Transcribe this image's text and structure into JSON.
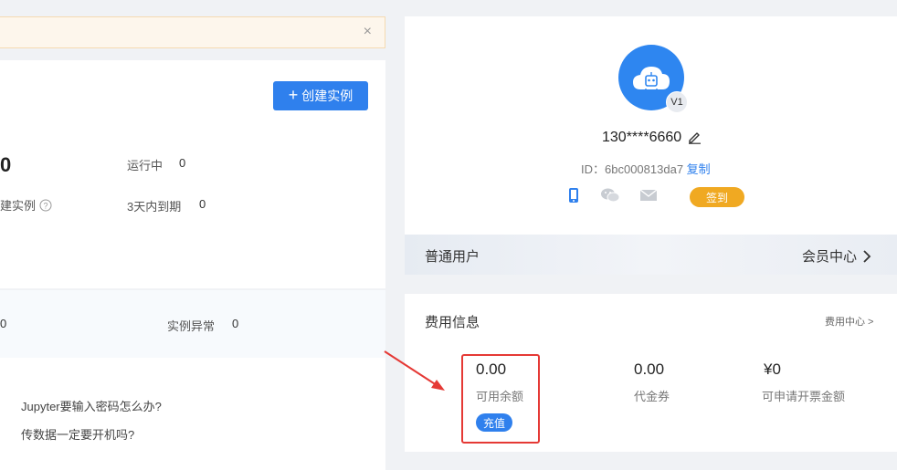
{
  "notice": {
    "close_glyph": "×"
  },
  "instances": {
    "create_label": "创建实例",
    "total_value": "0",
    "running_label": "运行中",
    "running_value": "0",
    "partial_label": "建实例",
    "expiring_label": "3天内到期",
    "expiring_value": "0",
    "strip_value": "0",
    "abnormal_label": "实例异常",
    "abnormal_value": "0"
  },
  "faq": [
    "Jupyter要输入密码怎么办?",
    "传数据一定要开机吗?"
  ],
  "profile": {
    "level_badge": "V1",
    "phone": "130****6660",
    "id_label": "ID：",
    "id_value": "6bc000813da7",
    "copy_label": "复制",
    "sign_label": "签到",
    "member_type": "普通用户",
    "member_center": "会员中心"
  },
  "fees": {
    "title": "费用信息",
    "center_link": "费用中心 >",
    "balance_value": "0.00",
    "balance_label": "可用余额",
    "recharge_label": "充值",
    "voucher_value": "0.00",
    "voucher_label": "代金券",
    "invoice_value": "¥0",
    "invoice_label": "可申请开票金额"
  },
  "colors": {
    "primary": "#2f80ed",
    "sign": "#f0a922",
    "highlight": "#e53935"
  }
}
